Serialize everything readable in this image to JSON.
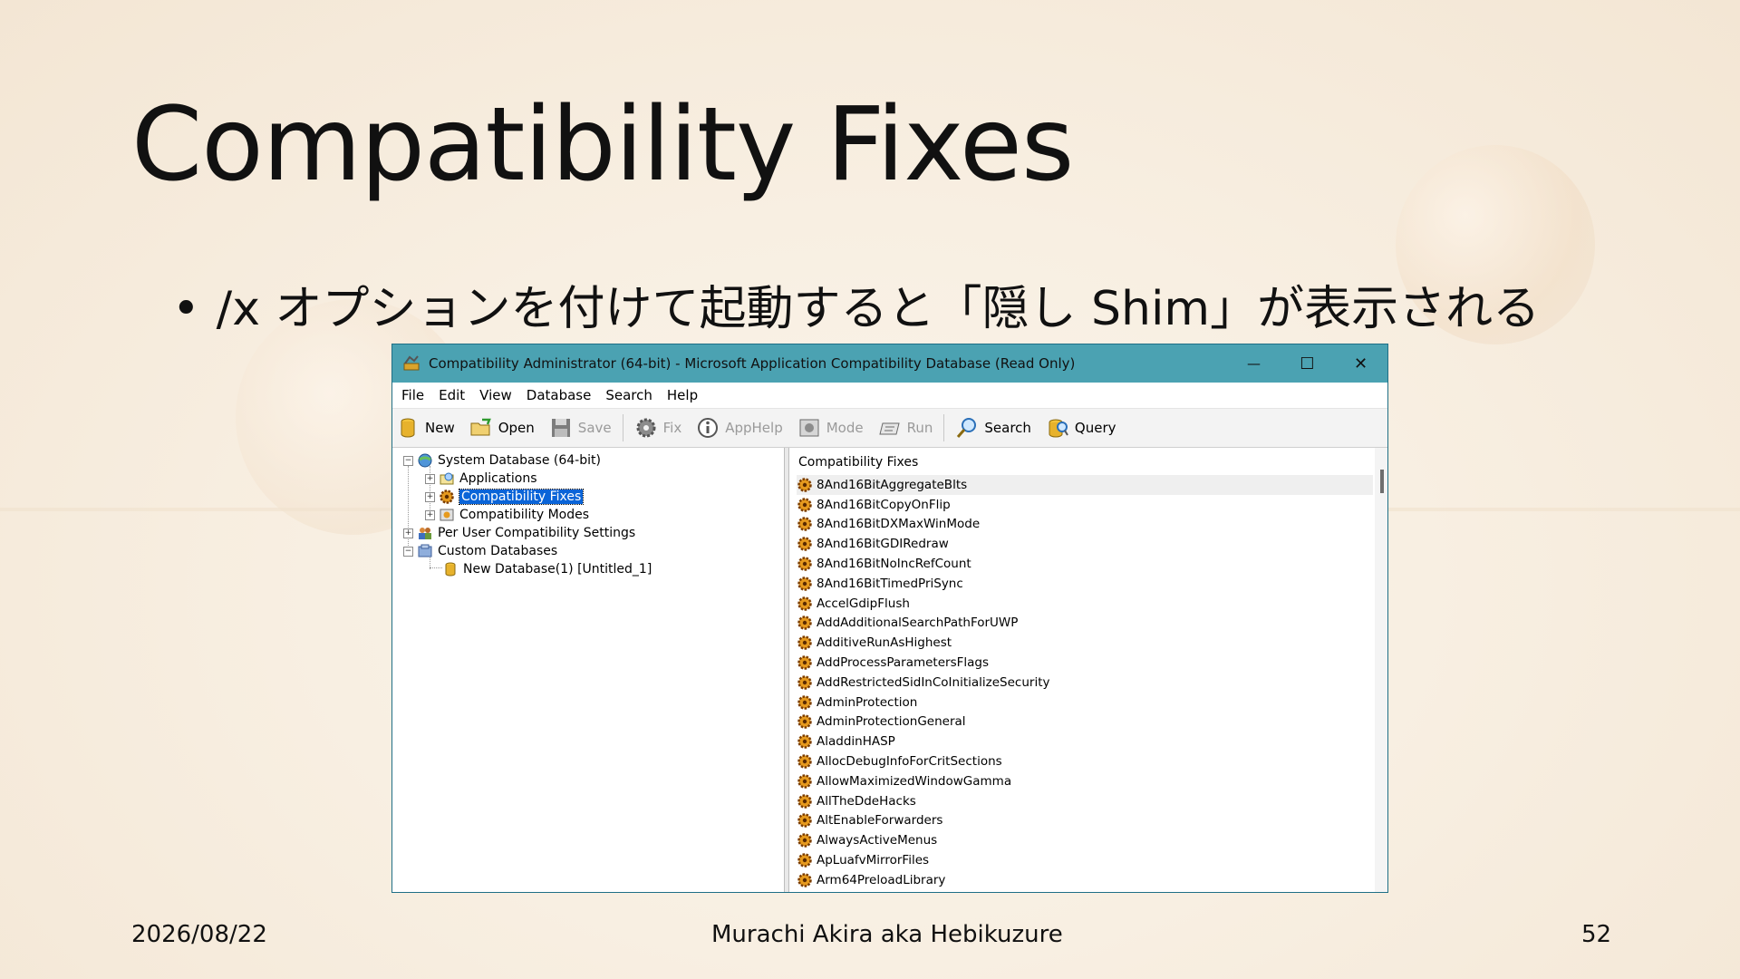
{
  "slide": {
    "title": "Compatibility Fixes",
    "bullet_mark": "•",
    "bullet_text": "/x オプションを付けて起動すると「隠し Shim」が表示される",
    "footer": {
      "date": "2026/08/22",
      "author": "Murachi Akira aka Hebikuzure",
      "page": "52"
    }
  },
  "window": {
    "title": "Compatibility Administrator (64-bit) - Microsoft Application Compatibility Database (Read Only)",
    "controls": {
      "minimize": "—",
      "maximize": "☐",
      "close": "✕"
    },
    "menu": [
      "File",
      "Edit",
      "View",
      "Database",
      "Search",
      "Help"
    ],
    "toolbar": {
      "new": "New",
      "open": "Open",
      "save": "Save",
      "fix": "Fix",
      "apphelp": "AppHelp",
      "mode": "Mode",
      "run": "Run",
      "search": "Search",
      "query": "Query"
    },
    "tree": {
      "system_db": "System Database (64-bit)",
      "applications": "Applications",
      "compat_fixes": "Compatibility Fixes",
      "compat_modes": "Compatibility Modes",
      "per_user": "Per User Compatibility Settings",
      "custom_dbs": "Custom Databases",
      "new_db": "New Database(1) [Untitled_1]"
    },
    "right_header": "Compatibility Fixes",
    "fixes": [
      "8And16BitAggregateBlts",
      "8And16BitCopyOnFlip",
      "8And16BitDXMaxWinMode",
      "8And16BitGDIRedraw",
      "8And16BitNoIncRefCount",
      "8And16BitTimedPriSync",
      "AccelGdipFlush",
      "AddAdditionalSearchPathForUWP",
      "AdditiveRunAsHighest",
      "AddProcessParametersFlags",
      "AddRestrictedSidInCoInitializeSecurity",
      "AdminProtection",
      "AdminProtectionGeneral",
      "AladdinHASP",
      "AllocDebugInfoForCritSections",
      "AllowMaximizedWindowGamma",
      "AllTheDdeHacks",
      "AltEnableForwarders",
      "AlwaysActiveMenus",
      "ApLuafvMirrorFiles",
      "Arm64PreloadLibrary"
    ]
  }
}
